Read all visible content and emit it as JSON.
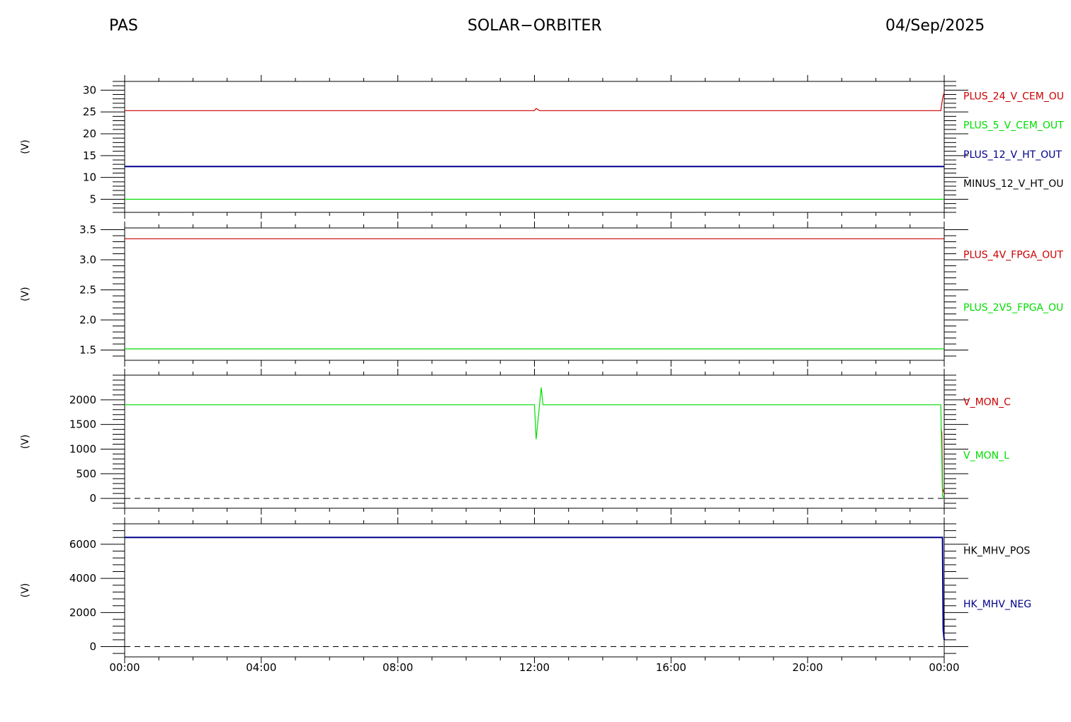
{
  "header": {
    "left": "PAS",
    "center": "SOLAR−ORBITER",
    "right": "04/Sep/2025"
  },
  "x_axis": {
    "tick_labels": [
      "00:00",
      "04:00",
      "08:00",
      "12:00",
      "16:00",
      "20:00",
      "00:00"
    ],
    "range_hours": [
      0,
      24
    ]
  },
  "chart_data": [
    {
      "type": "line",
      "ylabel": "(V)",
      "ylim": [
        2,
        32
      ],
      "y_ticks": [
        5,
        10,
        15,
        20,
        25,
        30
      ],
      "y_tick_labels": [
        "5",
        "10",
        "15",
        "20",
        "25",
        "30"
      ],
      "series": [
        {
          "name": "PLUS_24_V_CEM_OU",
          "color": "#cc0000",
          "x": [
            0,
            12.0,
            12.05,
            12.15,
            23.9,
            23.95,
            24.0
          ],
          "y": [
            25.3,
            25.3,
            25.8,
            25.3,
            25.3,
            28.0,
            29.5
          ]
        },
        {
          "name": "PLUS_5_V_CEM_OUT",
          "color": "#00dd00",
          "x": [
            0,
            24
          ],
          "y": [
            5.0,
            5.0
          ]
        },
        {
          "name": "PLUS_12_V_HT_OUT",
          "color": "#00008b",
          "x": [
            0,
            24
          ],
          "y": [
            12.5,
            12.5
          ]
        },
        {
          "name": "MINUS_12_V_HT_OU",
          "color": "#000000",
          "x": [],
          "y": []
        }
      ],
      "legend": "right"
    },
    {
      "type": "line",
      "ylabel": "(V)",
      "ylim": [
        1.33,
        3.53
      ],
      "y_ticks": [
        1.5,
        2.0,
        2.5,
        3.0,
        3.5
      ],
      "y_tick_labels": [
        "1.5",
        "2.0",
        "2.5",
        "3.0",
        "3.5"
      ],
      "series": [
        {
          "name": "PLUS_4V_FPGA_OUT",
          "color": "#cc0000",
          "x": [
            0,
            24
          ],
          "y": [
            3.35,
            3.35
          ]
        },
        {
          "name": "PLUS_2V5_FPGA_OU",
          "color": "#00dd00",
          "x": [
            0,
            24
          ],
          "y": [
            1.52,
            1.52
          ]
        }
      ],
      "legend": "right"
    },
    {
      "type": "line",
      "ylabel": "(V)",
      "ylim": [
        -200,
        2500
      ],
      "y_ticks": [
        0,
        500,
        1000,
        1500,
        2000
      ],
      "y_tick_labels": [
        "0",
        "500",
        "1000",
        "1500",
        "2000"
      ],
      "zero_line": true,
      "series": [
        {
          "name": "V_MON_C",
          "color": "#cc0000",
          "x": [
            23.9,
            23.93,
            23.95,
            24.0
          ],
          "y": [
            1400,
            1350,
            200,
            100
          ]
        },
        {
          "name": "V_MON_L",
          "color": "#00dd00",
          "x": [
            0,
            12.0,
            12.05,
            12.15,
            12.2,
            12.25,
            23.9,
            23.95,
            24.0
          ],
          "y": [
            1900,
            1900,
            1200,
            1900,
            2250,
            1900,
            1900,
            50,
            0
          ]
        }
      ],
      "legend": "right"
    },
    {
      "type": "line",
      "ylabel": "(V)",
      "ylim": [
        -600,
        7200
      ],
      "y_ticks": [
        0,
        2000,
        4000,
        6000
      ],
      "y_tick_labels": [
        "0",
        "2000",
        "4000",
        "6000"
      ],
      "zero_line": true,
      "series": [
        {
          "name": "HK_MHV_POS",
          "color": "#000000",
          "x": [],
          "y": []
        },
        {
          "name": "HK_MHV_NEG",
          "color": "#00008b",
          "x": [
            0,
            23.95,
            23.97,
            24.0
          ],
          "y": [
            6400,
            6400,
            1000,
            400
          ]
        }
      ],
      "legend": "right"
    }
  ]
}
